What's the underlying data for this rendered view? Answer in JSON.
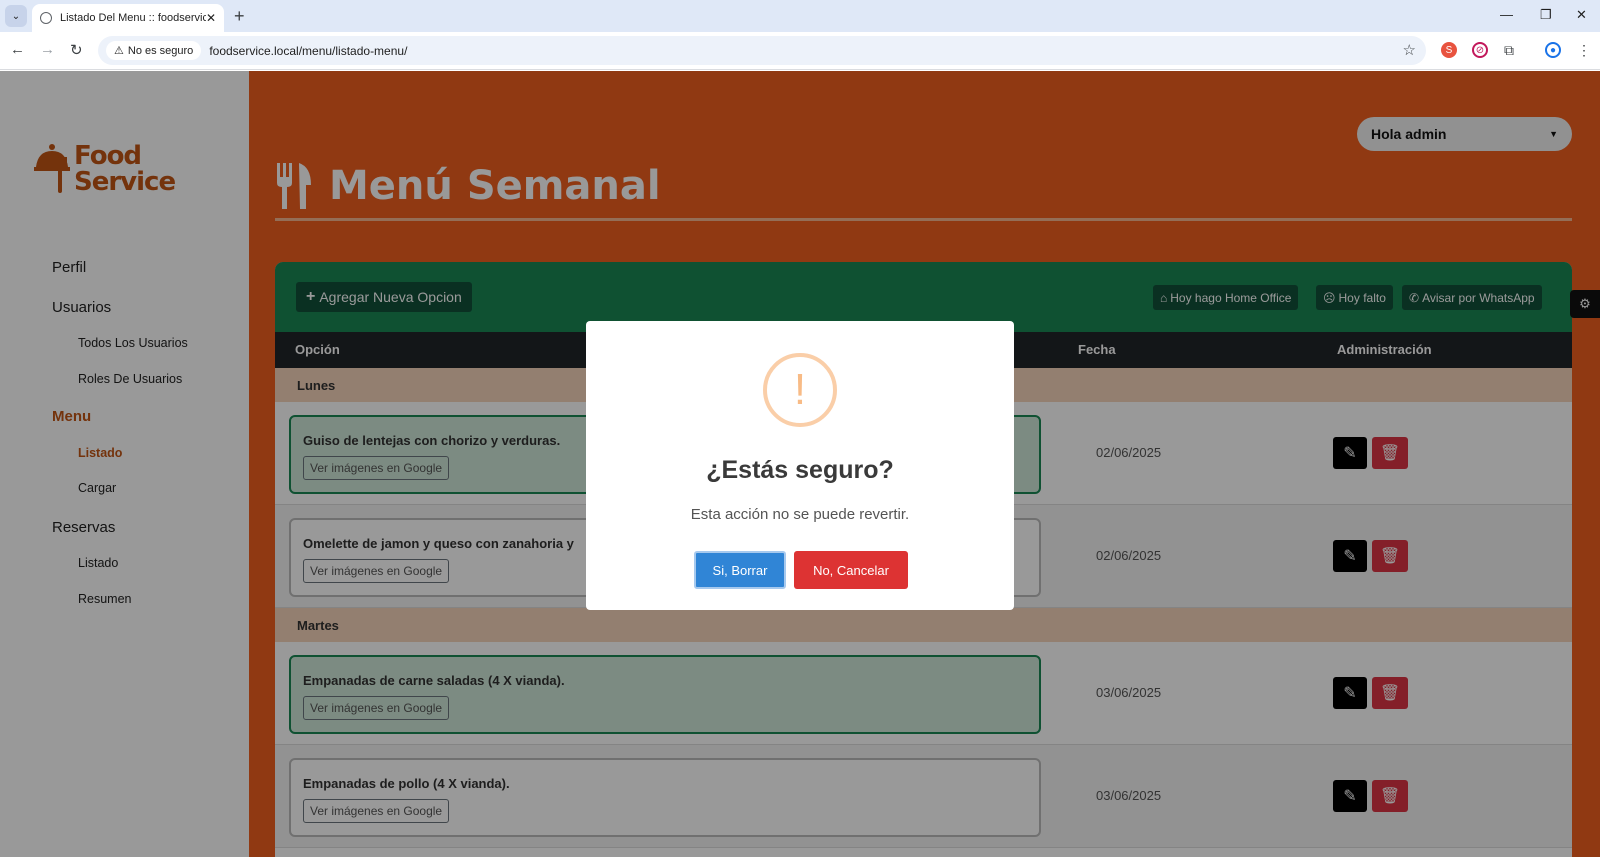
{
  "browser": {
    "tab_title": "Listado Del Menu :: foodservice",
    "security_label": "No es seguro",
    "url": "foodservice.local/menu/listado-menu/"
  },
  "sidebar": {
    "logo_line1": "Food",
    "logo_line2": "Service",
    "items": [
      {
        "label": "Perfil"
      },
      {
        "label": "Usuarios"
      },
      {
        "label": "Todos Los Usuarios"
      },
      {
        "label": "Roles De Usuarios"
      },
      {
        "label": "Menu"
      },
      {
        "label": "Listado"
      },
      {
        "label": "Cargar"
      },
      {
        "label": "Reservas"
      },
      {
        "label": "Listado"
      },
      {
        "label": "Resumen"
      }
    ]
  },
  "header": {
    "user_menu": "Hola admin",
    "page_title": "Menú Semanal"
  },
  "toolbar": {
    "add_label": "Agregar Nueva Opcion",
    "home_office_label": "Hoy hago Home Office",
    "absent_label": "Hoy falto",
    "whatsapp_label": "Avisar por WhatsApp"
  },
  "table": {
    "columns": [
      "Opción",
      "Fecha",
      "Administración"
    ],
    "days": [
      "Lunes",
      "Martes"
    ],
    "google_button": "Ver imágenes en Google",
    "rows": [
      {
        "name": "Guiso de lentejas con chorizo y verduras.",
        "date": "02/06/2025"
      },
      {
        "name": "Omelette de jamon y queso con zanahoria y",
        "date": "02/06/2025"
      },
      {
        "name": "Empanadas de carne saladas (4 X vianda).",
        "date": "03/06/2025"
      },
      {
        "name": "Empanadas de pollo (4 X vianda).",
        "date": "03/06/2025"
      }
    ]
  },
  "modal": {
    "icon": "!",
    "title": "¿Estás seguro?",
    "text": "Esta acción no se puede revertir.",
    "confirm_label": "Si, Borrar",
    "cancel_label": "No, Cancelar"
  },
  "colors": {
    "brand_orange": "#f05f1e",
    "green": "#198754",
    "danger": "#dc3545",
    "confirm_blue": "#3085d6"
  }
}
